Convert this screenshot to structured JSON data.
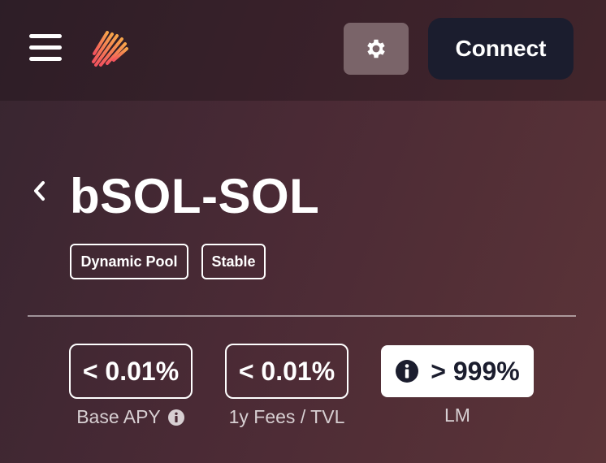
{
  "header": {
    "menu_icon": "hamburger-menu-icon",
    "logo_icon": "brand-stripes-logo",
    "settings_icon": "gear-icon",
    "connect_label": "Connect"
  },
  "pool": {
    "back_icon": "chevron-left-icon",
    "title": "bSOL-SOL",
    "badges": [
      "Dynamic Pool",
      "Stable"
    ]
  },
  "stats": [
    {
      "value": "< 0.01%",
      "label": "Base APY",
      "icon": "info-icon"
    },
    {
      "value": "< 0.01%",
      "label": "1y Fees / TVL"
    },
    {
      "value": "> 999%",
      "label": "LM",
      "icon": "info-icon"
    }
  ],
  "colors": {
    "logo_gradient_start": "#f2525e",
    "logo_gradient_end": "#f7a44a",
    "connect_bg": "#1b1d2e",
    "settings_bg": "#7a6469"
  }
}
